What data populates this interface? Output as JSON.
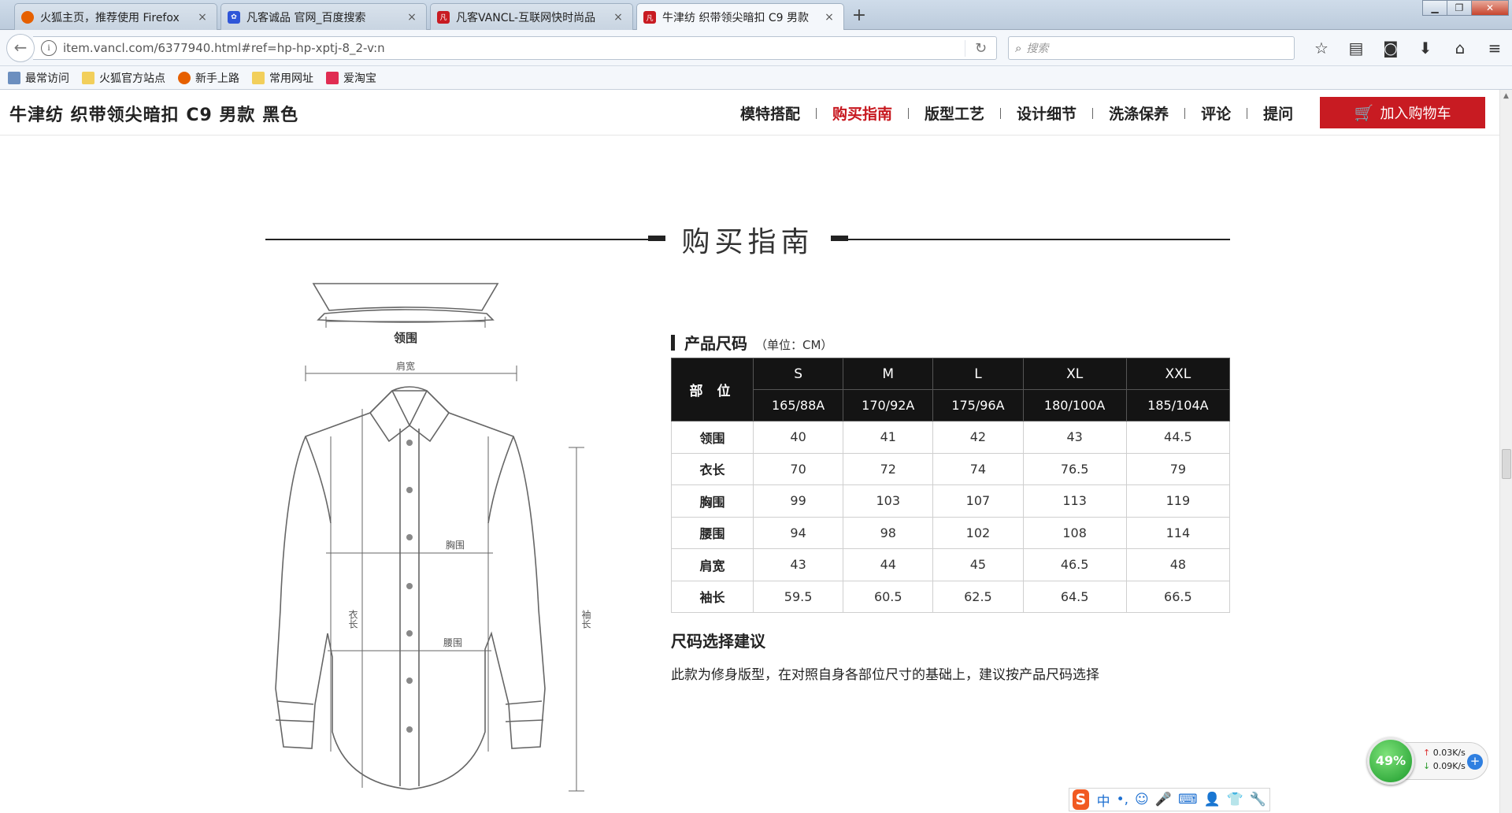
{
  "browser": {
    "tabs": [
      {
        "title": "火狐主页，推荐使用 Firefox",
        "icon": "firefox-icon"
      },
      {
        "title": "凡客诚品 官网_百度搜索",
        "icon": "baidu-paw-icon"
      },
      {
        "title": "凡客VANCL-互联网快时尚品",
        "icon": "vancl-icon"
      },
      {
        "title": "牛津纺 织带领尖暗扣 C9 男款",
        "icon": "vancl-icon"
      }
    ],
    "url": "item.vancl.com/6377940.html#ref=hp-hp-xptj-8_2-v:n",
    "search_placeholder": "搜索",
    "bookmarks": [
      "最常访问",
      "火狐官方站点",
      "新手上路",
      "常用网址",
      "爱淘宝"
    ]
  },
  "product": {
    "title": "牛津纺 织带领尖暗扣 C9 男款 黑色",
    "nav": [
      "模特搭配",
      "购买指南",
      "版型工艺",
      "设计细节",
      "洗涤保养",
      "评论",
      "提问"
    ],
    "active_nav": "购买指南",
    "cart_label": "加入购物车"
  },
  "guide": {
    "section_title": "购买指南",
    "diagram_labels": {
      "collar": "领围",
      "shoulder": "肩宽",
      "chest": "胸围",
      "length": "衣长",
      "waist": "腰围",
      "sleeve": "袖长"
    },
    "size_title": "产品尺码",
    "size_unit": "（单位：CM）",
    "part_header": "部 位",
    "sizes": [
      "S",
      "M",
      "L",
      "XL",
      "XXL"
    ],
    "codes": [
      "165/88A",
      "170/92A",
      "175/96A",
      "180/100A",
      "185/104A"
    ],
    "rows": [
      {
        "label": "领围",
        "values": [
          "40",
          "41",
          "42",
          "43",
          "44.5"
        ]
      },
      {
        "label": "衣长",
        "values": [
          "70",
          "72",
          "74",
          "76.5",
          "79"
        ]
      },
      {
        "label": "胸围",
        "values": [
          "99",
          "103",
          "107",
          "113",
          "119"
        ]
      },
      {
        "label": "腰围",
        "values": [
          "94",
          "98",
          "102",
          "108",
          "114"
        ]
      },
      {
        "label": "肩宽",
        "values": [
          "43",
          "44",
          "45",
          "46.5",
          "48"
        ]
      },
      {
        "label": "袖长",
        "values": [
          "59.5",
          "60.5",
          "62.5",
          "64.5",
          "66.5"
        ]
      }
    ],
    "advice_title": "尺码选择建议",
    "advice_text": "此款为修身版型，在对照自身各部位尺寸的基础上，建议按产品尺码选择"
  },
  "widgets": {
    "cpu": "49%",
    "up_speed": "0.03K/s",
    "down_speed": "0.09K/s",
    "ime_mode": "中"
  },
  "colors": {
    "accent": "#c81b22",
    "table_header": "#141414"
  }
}
